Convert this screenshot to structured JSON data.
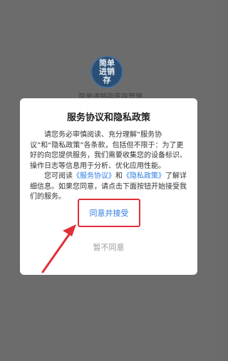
{
  "app": {
    "logo_text": "简单进销存",
    "subtitle": "简单进销存库存管理"
  },
  "dialog": {
    "title": "服务协议和隐私政策",
    "paragraph1": "请您务必审慎阅读、充分理解“服务协议”和“隐私政策”各条款，包括但不限于：为了更好的向您提供服务，我们需要收集您的设备标识、操作日志等信息用于分析、优化应用性能。",
    "p2_prefix": "您可阅读",
    "service_link": "《服务协议》",
    "p2_and": "和",
    "privacy_link": "《隐私政策》",
    "p2_suffix": "了解详细信息。如果您同意，请点击下面按钮开始接受我们的服务。",
    "accept_label": "同意并接受",
    "decline_label": "暂不同意"
  },
  "colors": {
    "overlay": "#6c6c6c",
    "link": "#2f7de1",
    "highlight": "#e0303a"
  }
}
